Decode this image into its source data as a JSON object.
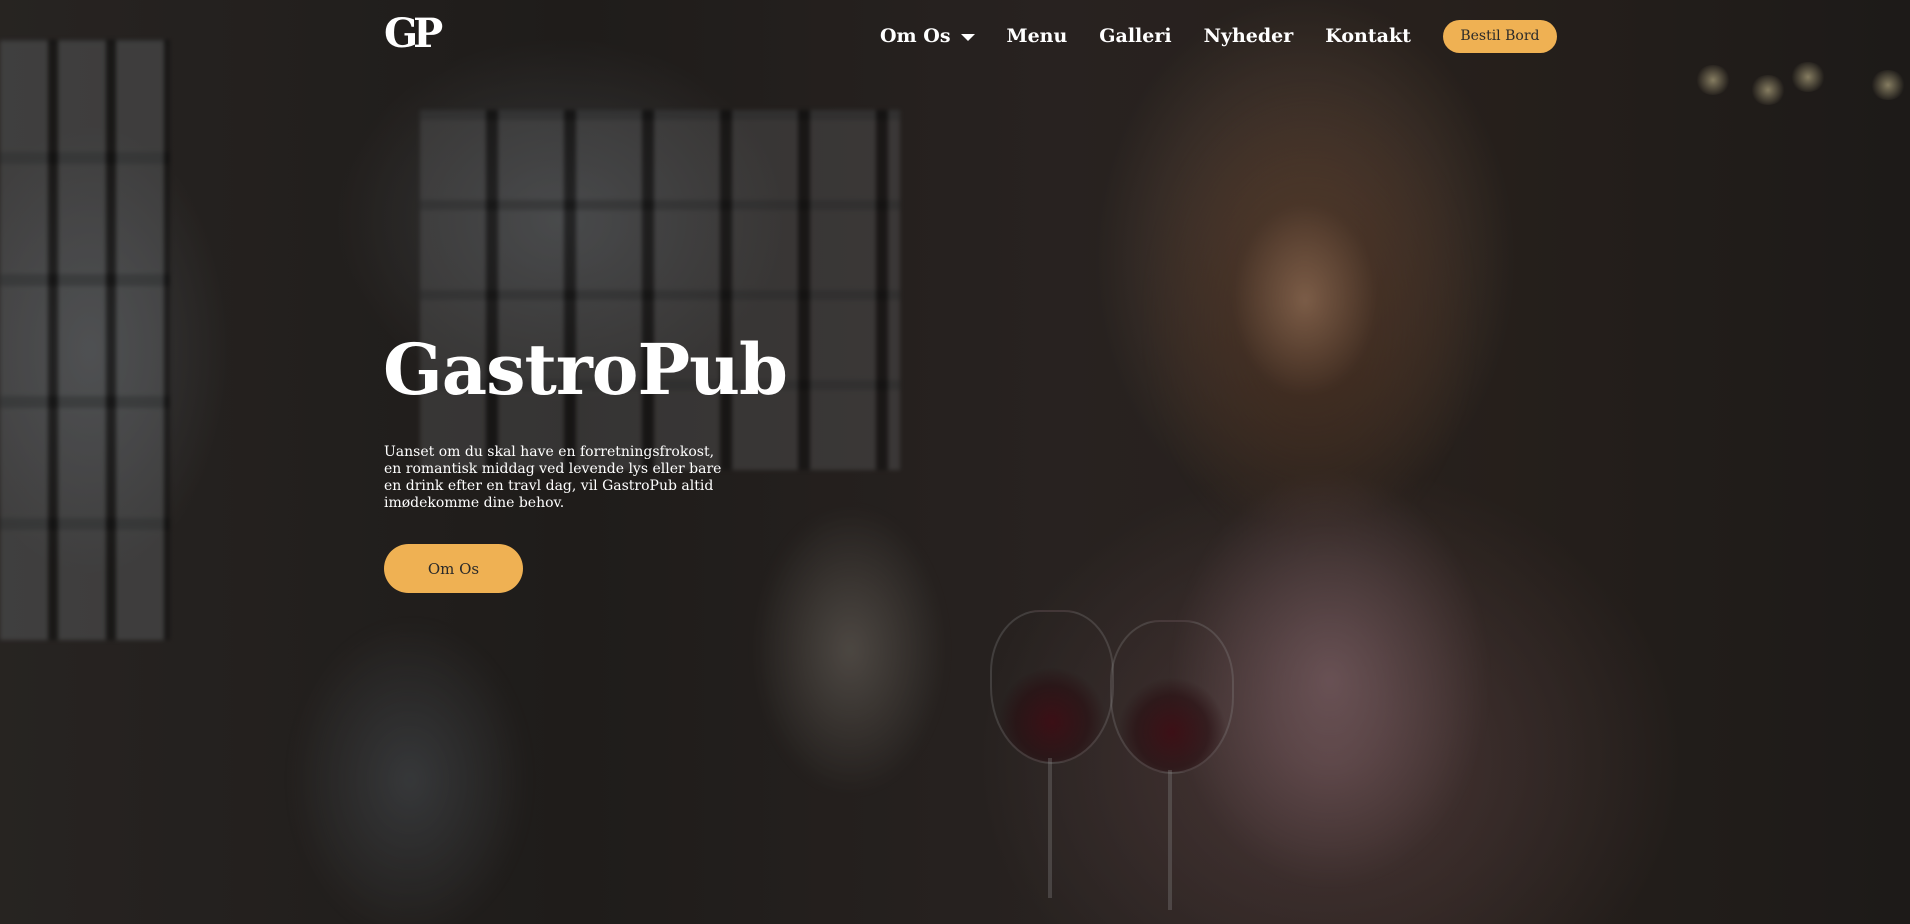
{
  "brand": {
    "logo_text": "GP"
  },
  "nav": {
    "items": [
      {
        "label": "Om Os",
        "has_dropdown": true
      },
      {
        "label": "Menu"
      },
      {
        "label": "Galleri"
      },
      {
        "label": "Nyheder"
      },
      {
        "label": "Kontakt"
      }
    ],
    "cta_label": "Bestil Bord"
  },
  "hero": {
    "title": "GastroPub",
    "description": "Uanset om du skal have en forretningsfrokost, en romantisk middag ved levende lys eller bare en drink efter en travl dag, vil GastroPub altid imødekomme dine behov.",
    "button_label": "Om Os"
  },
  "colors": {
    "accent": "#efb153",
    "text_light": "#ffffff",
    "button_text": "#2a2a2a"
  },
  "icons": {
    "dropdown": "chevron-down-icon"
  }
}
